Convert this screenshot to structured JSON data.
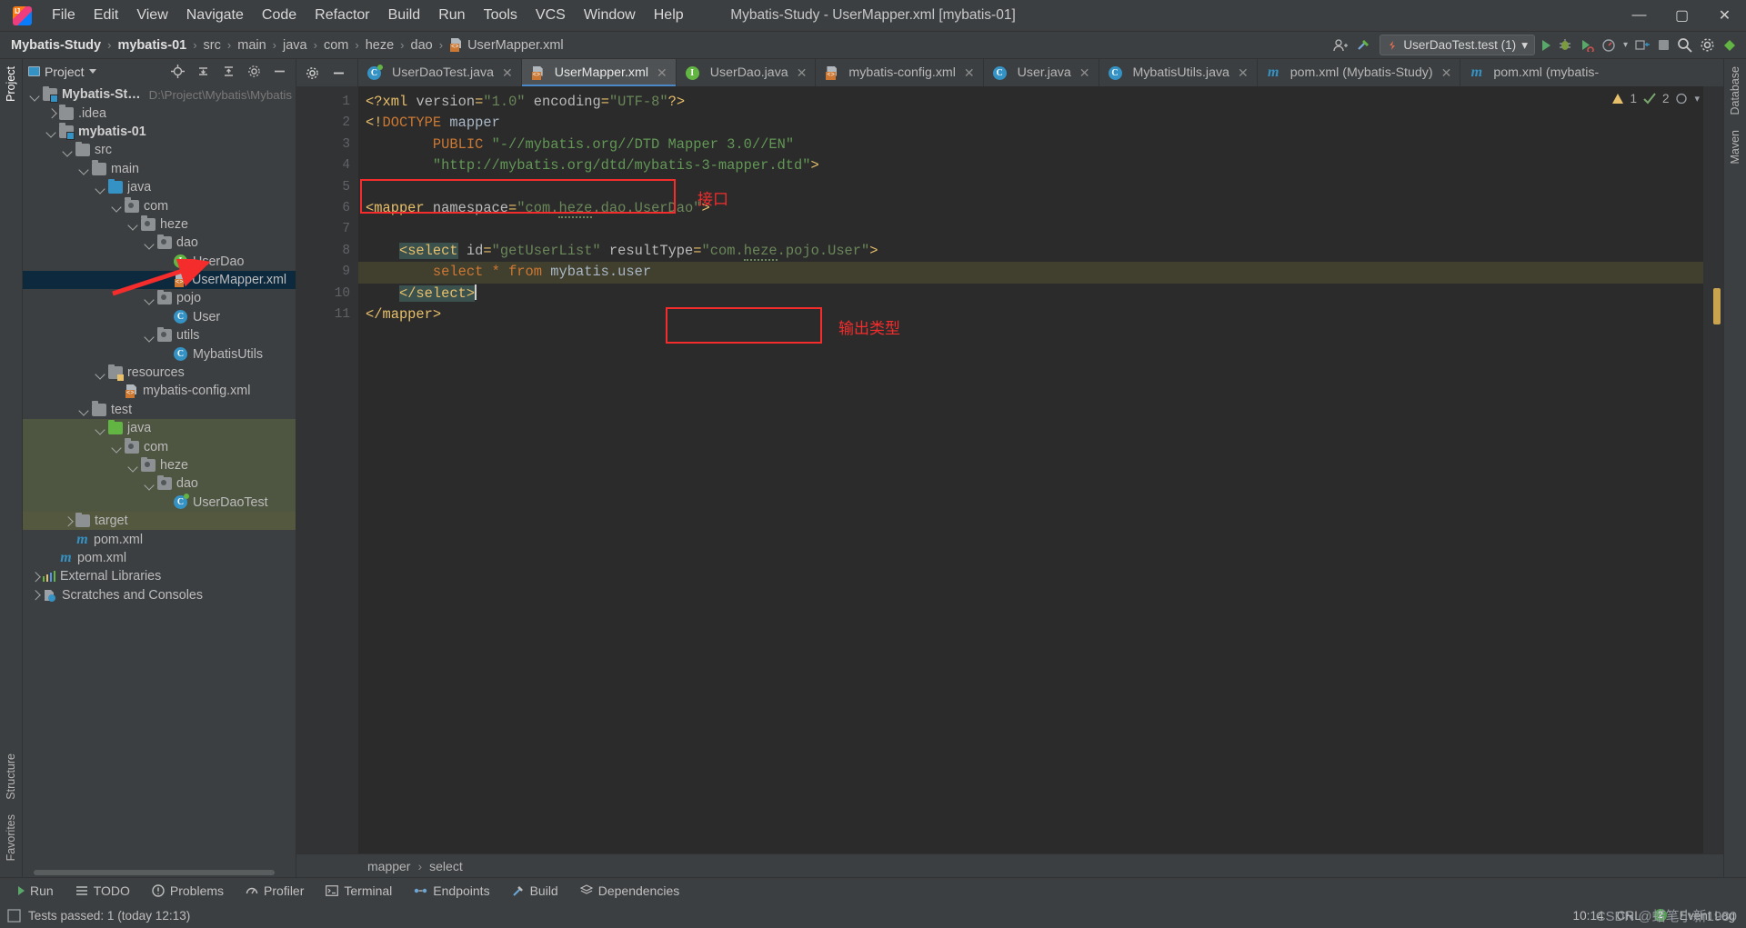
{
  "window": {
    "title": "Mybatis-Study - UserMapper.xml [mybatis-01]",
    "minimize": "—",
    "maximize": "▢",
    "close": "✕"
  },
  "menu": [
    "File",
    "Edit",
    "View",
    "Navigate",
    "Code",
    "Refactor",
    "Build",
    "Run",
    "Tools",
    "VCS",
    "Window",
    "Help"
  ],
  "breadcrumb": {
    "items": [
      "Mybatis-Study",
      "mybatis-01",
      "src",
      "main",
      "java",
      "com",
      "heze",
      "dao",
      "UserMapper.xml"
    ],
    "separator": "›"
  },
  "run_config": {
    "label": "UserDaoTest.test (1)",
    "dropdown": "▾"
  },
  "project_panel": {
    "title": "Project",
    "tree": [
      {
        "depth": 0,
        "arrow": "down",
        "icon": "module-folder",
        "label": "Mybatis-Study",
        "bold": true,
        "path": "D:\\Project\\Mybatis\\Mybatis",
        "state": "normal"
      },
      {
        "depth": 1,
        "arrow": "right",
        "icon": "folder-gray",
        "label": ".idea",
        "bold": false,
        "state": "normal"
      },
      {
        "depth": 1,
        "arrow": "down",
        "icon": "module-folder",
        "label": "mybatis-01",
        "bold": true,
        "state": "normal"
      },
      {
        "depth": 2,
        "arrow": "down",
        "icon": "folder-gray",
        "label": "src",
        "bold": false,
        "state": "normal"
      },
      {
        "depth": 3,
        "arrow": "down",
        "icon": "folder-gray",
        "label": "main",
        "bold": false,
        "state": "normal"
      },
      {
        "depth": 4,
        "arrow": "down",
        "icon": "folder-blue",
        "label": "java",
        "bold": false,
        "state": "normal"
      },
      {
        "depth": 5,
        "arrow": "down",
        "icon": "package",
        "label": "com",
        "bold": false,
        "state": "normal"
      },
      {
        "depth": 6,
        "arrow": "down",
        "icon": "package",
        "label": "heze",
        "bold": false,
        "state": "normal"
      },
      {
        "depth": 7,
        "arrow": "down",
        "icon": "package",
        "label": "dao",
        "bold": false,
        "state": "normal"
      },
      {
        "depth": 8,
        "arrow": "none",
        "icon": "interface",
        "label": "UserDao",
        "bold": false,
        "state": "normal"
      },
      {
        "depth": 8,
        "arrow": "none",
        "icon": "xml",
        "label": "UserMapper.xml",
        "bold": false,
        "state": "selected"
      },
      {
        "depth": 7,
        "arrow": "down",
        "icon": "package",
        "label": "pojo",
        "bold": false,
        "state": "normal"
      },
      {
        "depth": 8,
        "arrow": "none",
        "icon": "class",
        "label": "User",
        "bold": false,
        "state": "normal"
      },
      {
        "depth": 7,
        "arrow": "down",
        "icon": "package",
        "label": "utils",
        "bold": false,
        "state": "normal"
      },
      {
        "depth": 8,
        "arrow": "none",
        "icon": "class",
        "label": "MybatisUtils",
        "bold": false,
        "state": "normal"
      },
      {
        "depth": 4,
        "arrow": "down",
        "icon": "folder-resources",
        "label": "resources",
        "bold": false,
        "state": "normal"
      },
      {
        "depth": 5,
        "arrow": "none",
        "icon": "xml",
        "label": "mybatis-config.xml",
        "bold": false,
        "state": "normal"
      },
      {
        "depth": 3,
        "arrow": "down",
        "icon": "folder-gray",
        "label": "test",
        "bold": false,
        "state": "normal"
      },
      {
        "depth": 4,
        "arrow": "down",
        "icon": "folder-green",
        "label": "java",
        "bold": false,
        "state": "highlight"
      },
      {
        "depth": 5,
        "arrow": "down",
        "icon": "package",
        "label": "com",
        "bold": false,
        "state": "highlight"
      },
      {
        "depth": 6,
        "arrow": "down",
        "icon": "package",
        "label": "heze",
        "bold": false,
        "state": "highlight"
      },
      {
        "depth": 7,
        "arrow": "down",
        "icon": "package",
        "label": "dao",
        "bold": false,
        "state": "highlight"
      },
      {
        "depth": 8,
        "arrow": "none",
        "icon": "test-class",
        "label": "UserDaoTest",
        "bold": false,
        "state": "highlight"
      },
      {
        "depth": 2,
        "arrow": "right",
        "icon": "folder-gray",
        "label": "target",
        "bold": false,
        "state": "highlight2"
      },
      {
        "depth": 2,
        "arrow": "none",
        "icon": "maven",
        "label": "pom.xml",
        "bold": false,
        "state": "normal"
      },
      {
        "depth": 1,
        "arrow": "none",
        "icon": "maven",
        "label": "pom.xml",
        "bold": false,
        "state": "normal"
      },
      {
        "depth": 0,
        "arrow": "right",
        "icon": "libraries",
        "label": "External Libraries",
        "bold": false,
        "state": "normal"
      },
      {
        "depth": 0,
        "arrow": "right",
        "icon": "scratches",
        "label": "Scratches and Consoles",
        "bold": false,
        "state": "normal"
      }
    ]
  },
  "editor_tabs": [
    {
      "label": "UserDaoTest.java",
      "icon": "test-class",
      "active": false,
      "closable": true
    },
    {
      "label": "UserMapper.xml",
      "icon": "xml",
      "active": true,
      "closable": true
    },
    {
      "label": "UserDao.java",
      "icon": "interface",
      "active": false,
      "closable": true
    },
    {
      "label": "mybatis-config.xml",
      "icon": "xml",
      "active": false,
      "closable": true
    },
    {
      "label": "User.java",
      "icon": "class",
      "active": false,
      "closable": true
    },
    {
      "label": "MybatisUtils.java",
      "icon": "class",
      "active": false,
      "closable": true
    },
    {
      "label": "pom.xml (Mybatis-Study)",
      "icon": "maven",
      "active": false,
      "closable": true
    },
    {
      "label": "pom.xml (mybatis-",
      "icon": "maven",
      "active": false,
      "closable": false
    }
  ],
  "code": {
    "line_numbers": [
      "1",
      "2",
      "3",
      "4",
      "5",
      "6",
      "7",
      "8",
      "9",
      "10",
      "11"
    ],
    "lines": [
      "<?xml version=\"1.0\" encoding=\"UTF-8\"?>",
      "<!DOCTYPE mapper",
      "        PUBLIC \"-//mybatis.org//DTD Mapper 3.0//EN\"",
      "        \"http://mybatis.org/dtd/mybatis-3-mapper.dtd\">",
      "",
      "<mapper namespace=\"com.heze.dao.UserDao\">",
      "",
      "    <select id=\"getUserList\" resultType=\"com.heze.pojo.User\">",
      "        select * from mybatis.user",
      "    </select>",
      "</mapper>"
    ]
  },
  "annotations": [
    {
      "text": "接口",
      "color": "#f42c2c",
      "target_line": 6
    },
    {
      "text": "输出类型",
      "color": "#f42c2c",
      "target_line": 8
    }
  ],
  "inspection": {
    "warnings": "1",
    "weak_warnings": "2",
    "warn_icon": "warning-triangle",
    "check_icon": "checkmark"
  },
  "editor_breadcrumb": {
    "items": [
      "mapper",
      "select"
    ],
    "separator": "›"
  },
  "tool_windows": [
    {
      "label": "Run",
      "icon": "play-icon"
    },
    {
      "label": "TODO",
      "icon": "list-icon"
    },
    {
      "label": "Problems",
      "icon": "error-icon"
    },
    {
      "label": "Profiler",
      "icon": "gauge-icon"
    },
    {
      "label": "Terminal",
      "icon": "terminal-icon"
    },
    {
      "label": "Endpoints",
      "icon": "endpoints-icon"
    },
    {
      "label": "Build",
      "icon": "hammer-icon"
    },
    {
      "label": "Dependencies",
      "icon": "layers-icon"
    }
  ],
  "status_bar": {
    "message": "Tests passed: 1 (today 12:13)",
    "time": "10:14",
    "encoding": "CRL",
    "event_log": "Event Log",
    "event_count": "2"
  },
  "left_strip": [
    "Project",
    "Structure",
    "Favorites"
  ],
  "right_strip": [
    "Database",
    "Maven"
  ],
  "watermark": "CSDN @蜡笔小新1980",
  "colors": {
    "accent_blue": "#4a88c7",
    "annotation_red": "#f42c2c",
    "selection_blue": "#0d293e",
    "editor_bg": "#2b2b2b",
    "panel_bg": "#3c3f41"
  }
}
